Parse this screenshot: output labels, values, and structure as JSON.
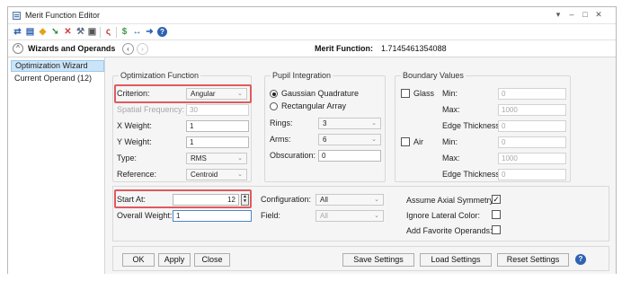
{
  "window": {
    "title": "Merit Function Editor",
    "controls": {
      "collapse": "▾",
      "minimize": "–",
      "maximize": "□",
      "close": "✕"
    }
  },
  "toolbar": {
    "icons": [
      "refresh-icon",
      "save-icon",
      "load-icon",
      "insert-icon",
      "delete-icon",
      "tools-icon",
      "window-icon",
      "optimize-icon",
      "settings-icon",
      "swap-icon",
      "next-icon",
      "help-icon"
    ]
  },
  "wizards_bar": {
    "label": "Wizards and Operands",
    "toggle_glyph": "^",
    "prev_glyph": "‹",
    "next_glyph": "›",
    "merit_label": "Merit Function:",
    "merit_value": "1.7145461354088"
  },
  "left_nav": {
    "items": [
      {
        "label": "Optimization Wizard",
        "active": true
      },
      {
        "label": "Current Operand (12)",
        "active": false
      }
    ]
  },
  "optimization_function": {
    "title": "Optimization Function",
    "criterion": {
      "label": "Criterion:",
      "value": "Angular"
    },
    "spatial_frequency": {
      "label": "Spatial Frequency:",
      "value": "30"
    },
    "x_weight": {
      "label": "X Weight:",
      "value": "1"
    },
    "y_weight": {
      "label": "Y Weight:",
      "value": "1"
    },
    "type": {
      "label": "Type:",
      "value": "RMS"
    },
    "reference": {
      "label": "Reference:",
      "value": "Centroid"
    }
  },
  "pupil_integration": {
    "title": "Pupil Integration",
    "gaussian_quadrature": {
      "label": "Gaussian Quadrature",
      "selected": true
    },
    "rectangular_array": {
      "label": "Rectangular Array",
      "selected": false
    },
    "rings": {
      "label": "Rings:",
      "value": "3"
    },
    "arms": {
      "label": "Arms:",
      "value": "6"
    },
    "obscuration": {
      "label": "Obscuration:",
      "value": "0"
    }
  },
  "boundary_values": {
    "title": "Boundary Values",
    "glass": {
      "label": "Glass",
      "checked": false,
      "min_label": "Min:",
      "min": "0",
      "max_label": "Max:",
      "max": "1000",
      "edge_label": "Edge Thickness:",
      "edge": "0"
    },
    "air": {
      "label": "Air",
      "checked": false,
      "min_label": "Min:",
      "min": "0",
      "max_label": "Max:",
      "max": "1000",
      "edge_label": "Edge Thickness:",
      "edge": "0"
    }
  },
  "lower": {
    "start_at": {
      "label": "Start At:",
      "value": "12"
    },
    "overall_weight": {
      "label": "Overall Weight:",
      "value": "1"
    },
    "configuration": {
      "label": "Configuration:",
      "value": "All"
    },
    "field": {
      "label": "Field:",
      "value": "All"
    },
    "assume_axial_symmetry": {
      "label": "Assume Axial Symmetry:",
      "checked": true,
      "mark": "✓"
    },
    "ignore_lateral_color": {
      "label": "Ignore Lateral Color:",
      "checked": false
    },
    "add_favorite_operands": {
      "label": "Add Favorite Operands:",
      "checked": false
    }
  },
  "buttons": {
    "ok": "OK",
    "apply": "Apply",
    "close": "Close",
    "save_settings": "Save Settings",
    "load_settings": "Load Settings",
    "reset_settings": "Reset Settings",
    "help_glyph": "?"
  },
  "colors": {
    "highlight_border": "#e05a5e",
    "active_nav": "#cce4f7",
    "help_blue": "#2f63b2"
  }
}
